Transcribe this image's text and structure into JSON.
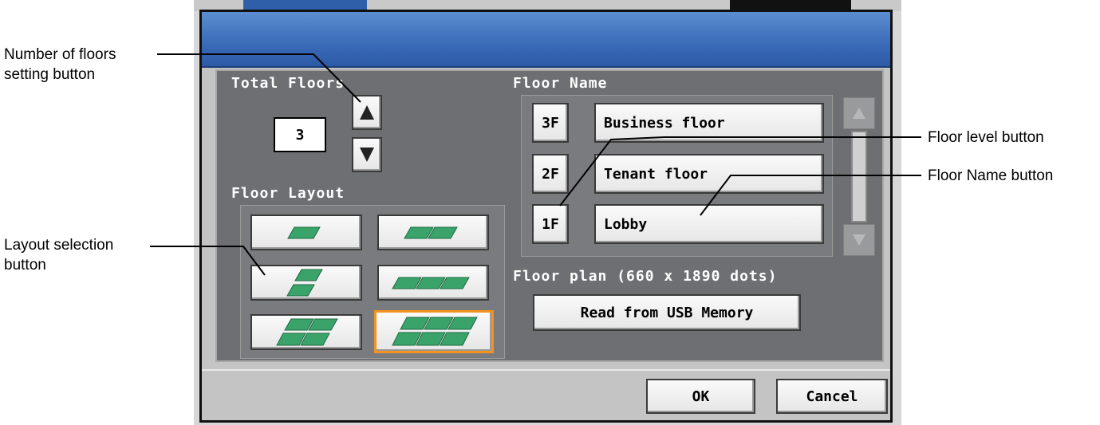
{
  "callouts": {
    "floors_setting": [
      "Number of floors",
      "setting button"
    ],
    "layout_selection": [
      "Layout selection",
      "button"
    ],
    "floor_level": "Floor level button",
    "floor_name": "Floor Name button"
  },
  "dialog": {
    "title": "",
    "total_floors": {
      "label": "Total Floors",
      "value": "3",
      "up_icon": "triangle-up-icon",
      "down_icon": "triangle-down-icon"
    },
    "floor_layout": {
      "label": "Floor Layout",
      "options": [
        {
          "tiles": "1x1",
          "selected": false
        },
        {
          "tiles": "2x1",
          "selected": false
        },
        {
          "tiles": "1x2 staggered",
          "selected": false
        },
        {
          "tiles": "3x1",
          "selected": false
        },
        {
          "tiles": "2x2",
          "selected": false
        },
        {
          "tiles": "3x2",
          "selected": true
        }
      ],
      "tile_color": "#3aa36a",
      "selected_color": "#f4921f"
    },
    "floor_name": {
      "label": "Floor Name",
      "rows": [
        {
          "level": "3F",
          "name": "Business floor"
        },
        {
          "level": "2F",
          "name": "Tenant floor"
        },
        {
          "level": "1F",
          "name": "Lobby"
        }
      ]
    },
    "floor_plan": {
      "label": "Floor plan (660 x 1890 dots)",
      "read_button": "Read from USB Memory"
    },
    "ok_label": "OK",
    "cancel_label": "Cancel"
  }
}
